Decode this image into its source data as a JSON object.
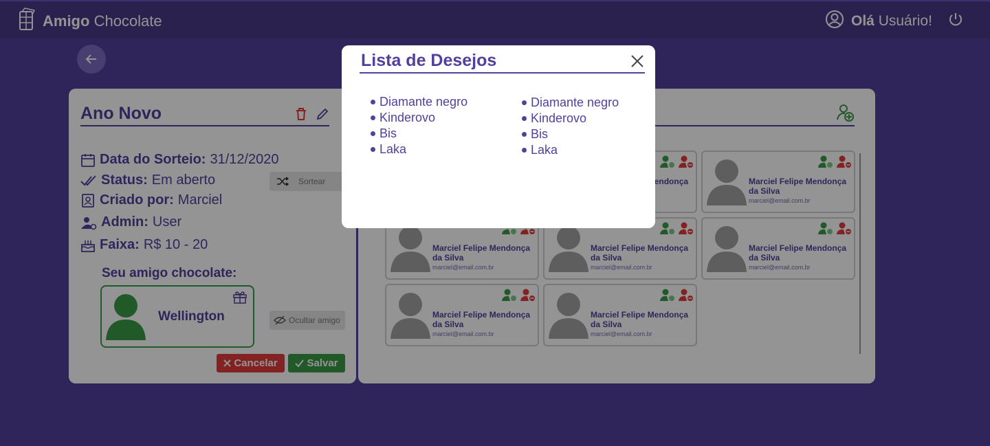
{
  "header": {
    "brand_bold": "Amigo",
    "brand_light": "Chocolate",
    "greeting_bold": "Olá",
    "greeting_light": "Usuário!"
  },
  "event": {
    "title": "Ano Novo",
    "draw_date_label": "Data do Sorteio:",
    "draw_date_value": "31/12/2020",
    "status_label": "Status:",
    "status_value": "Em aberto",
    "created_by_label": "Criado por:",
    "created_by_value": "Marciel",
    "admin_label": "Admin:",
    "admin_value": "User",
    "range_label": "Faixa:",
    "range_value": "R$ 10 - 20",
    "sort_label": "Sortear",
    "friend_label": "Seu amigo chocolate:",
    "friend_name": "Wellington",
    "hide_label": "Ocultar amigo",
    "cancel_label": "Cancelar",
    "save_label": "Salvar"
  },
  "participants": {
    "items": [
      {
        "name": "Marciel Felipe Mendonça da Silva",
        "email": "marciel@email.com.br"
      },
      {
        "name": "Marciel Felipe Mendonça da Silva",
        "email": "marciel@email.com.br"
      },
      {
        "name": "Marciel Felipe Mendonça da Silva",
        "email": "marciel@email.com.br"
      },
      {
        "name": "Marciel Felipe Mendonça da Silva",
        "email": "marciel@email.com.br"
      },
      {
        "name": "Marciel Felipe Mendonça da Silva",
        "email": "marciel@email.com.br"
      },
      {
        "name": "Marciel Felipe Mendonça da Silva",
        "email": "marciel@email.com.br"
      },
      {
        "name": "Marciel Felipe Mendonça da Silva",
        "email": "marciel@email.com.br"
      }
    ]
  },
  "modal": {
    "title": "Lista de Desejos",
    "list_left": [
      "Diamante negro",
      "Kinderovo",
      "Bis",
      "Laka"
    ],
    "list_right": [
      "Diamante negro",
      "Kinderovo",
      "Bis",
      "Laka"
    ]
  },
  "colors": {
    "primary": "#53409d",
    "header_bg": "#4a3989",
    "danger": "#e23b3b",
    "success": "#3a9a48"
  }
}
